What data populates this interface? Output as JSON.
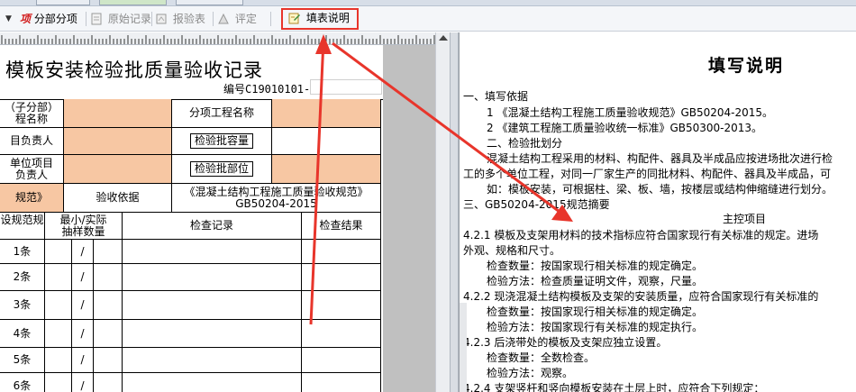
{
  "toolbar": {
    "items": [
      {
        "label": "分部分项",
        "icon": "item-icon",
        "enabled": true
      },
      {
        "label": "原始记录",
        "icon": "record-icon",
        "enabled": false
      },
      {
        "label": "报验表",
        "icon": "report-icon",
        "enabled": false
      },
      {
        "label": "评定",
        "icon": "evaluate-icon",
        "enabled": false
      },
      {
        "label": "填表说明",
        "icon": "guide-icon",
        "enabled": true
      }
    ],
    "item_glyph": "项"
  },
  "left_form": {
    "title": "模板安装检验批质量验收记录",
    "serial_label": "编号C19010101-",
    "serial_value": "",
    "rows": {
      "r1_c0": "（子分部）\n程名称",
      "r1_c2": "分项工程名称",
      "r2_c0": "目负责人",
      "r2_c2": "检验批容量",
      "r3_c0": "单位项目\n负责人",
      "r3_c2": "检验批部位",
      "r4_c0": "规范》",
      "r4_c1": "验收依据",
      "r4_c2": "《混凝土结构工程施工质量验收规范》GB50204-2015",
      "h_c0": "设规范规",
      "h_c1": "最小/实际\n抽样数量",
      "h_c2": "检查记录",
      "h_c3": "检查结果"
    },
    "items": [
      "1条",
      "2条",
      "3条",
      "4条",
      "5条",
      "6条"
    ],
    "slash": "/"
  },
  "right_doc": {
    "title": "填写说明",
    "lines": [
      "一、填写依据",
      "1  《混凝土结构工程施工质量验收规范》GB50204-2015。",
      "2  《建筑工程施工质量验收统一标准》GB50300-2013。",
      "二、检验批划分",
      "混凝土结构工程采用的材料、构配件、器具及半成品应按进场批次进行检",
      "工的多个单位工程，对同一厂家生产的同批材料、构配件、器具及半成品，可",
      "如：模板安装，可根据柱、梁、板、墙，按楼层或结构伸缩缝进行划分。",
      "三、GB50204-2015规范摘要",
      "主控项目",
      "4.2.1  模板及支架用材料的技术指标应符合国家现行有关标准的规定。进场",
      "外观、规格和尺寸。",
      "检查数量：按国家现行相关标准的规定确定。",
      "检验方法：检查质量证明文件，观察，尺量。",
      "4.2.2  现浇混凝土结构模板及支架的安装质量，应符合国家现行有关标准的",
      "检查数量：按国家现行相关标准的规定确定。",
      "检验方法：按国家现行有关标准的规定执行。",
      "4.2.3  后浇带处的模板及支架应独立设置。",
      "检查数量：全数检查。",
      "检验方法：观察。",
      "4.2.4  支架竖杆和竖向模板安装在土层上时，应符合下列规定："
    ]
  },
  "colors": {
    "orange_cell": "#f7c7a3",
    "annotation_red": "#e8352b"
  }
}
